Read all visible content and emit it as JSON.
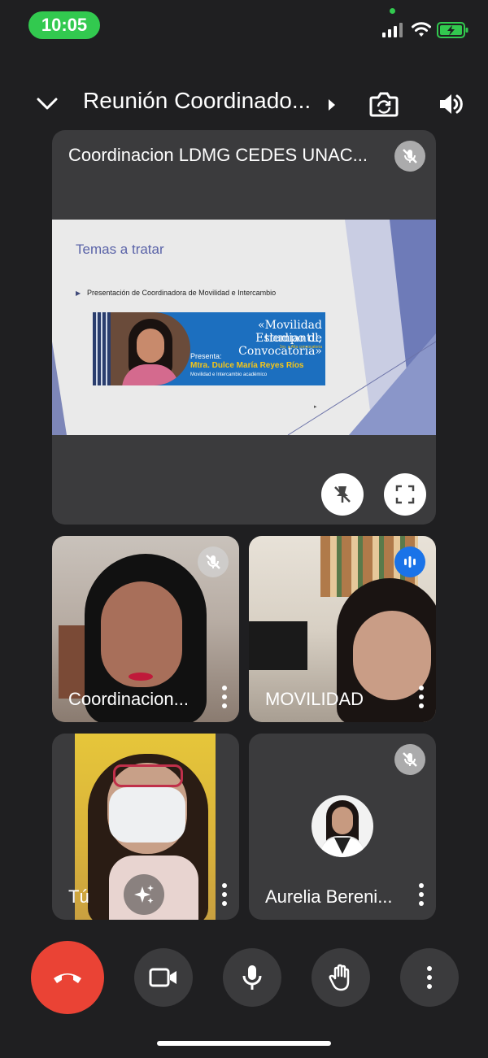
{
  "status_bar": {
    "time": "10:05"
  },
  "header": {
    "title": "Reunión Coordinado..."
  },
  "presentation": {
    "presenter_name": "Coordinacion LDMG CEDES UNAC...",
    "slide": {
      "heading": "Temas a tratar",
      "bullet": "Presentación de Coordinadora de Movilidad e Intercambio",
      "banner_title_1": "«Movilidad Estudiantil,",
      "banner_title_2": "tiempo de Convocatoria»",
      "banner_small": "1ro. a Alta convocatoria",
      "banner_presenta": "Presenta:",
      "banner_name": "Mtra. Dulce María Reyes Ríos",
      "banner_role": "Movilidad e Intercambio académico"
    }
  },
  "participants": [
    {
      "name": "Coordinacion..."
    },
    {
      "name": "MOVILIDAD"
    },
    {
      "name": "Tú"
    },
    {
      "name": "Aurelia Bereni..."
    }
  ],
  "colors": {
    "hangup": "#ea4335",
    "speaking": "#1a73e8",
    "status_green": "#32c94f"
  }
}
